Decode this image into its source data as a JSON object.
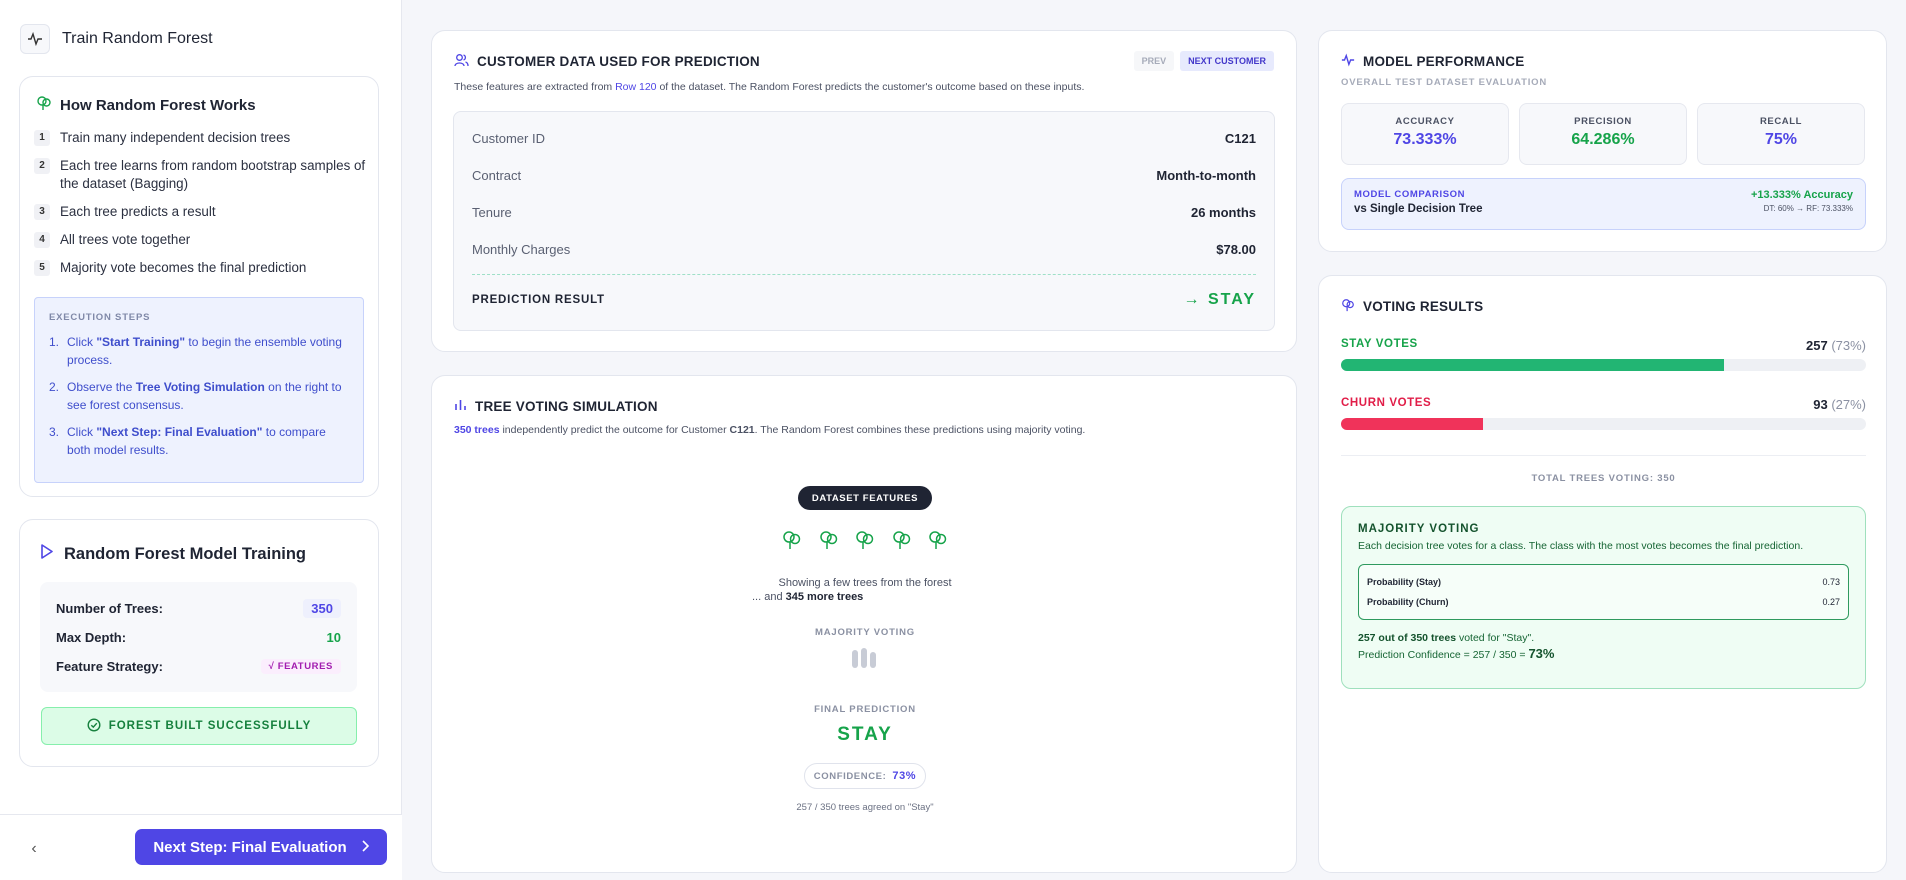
{
  "sidebar": {
    "header_title": "Train Random Forest",
    "how": {
      "title": "How Random Forest Works",
      "steps": [
        {
          "n": "1",
          "text": "Train many independent decision trees"
        },
        {
          "n": "2",
          "text": "Each tree learns from random bootstrap samples of the dataset (Bagging)"
        },
        {
          "n": "3",
          "text": "Each tree predicts a result"
        },
        {
          "n": "4",
          "text": "All trees vote together"
        },
        {
          "n": "5",
          "text": "Majority vote becomes the final prediction"
        }
      ],
      "exec_label": "EXECUTION STEPS",
      "exec_steps": [
        {
          "n": "1.",
          "pre": "Click ",
          "bold": "\"Start Training\"",
          "post": " to begin the ensemble voting process."
        },
        {
          "n": "2.",
          "pre": "Observe the ",
          "bold": "Tree Voting Simulation",
          "post": " on the right to see forest consensus."
        },
        {
          "n": "3.",
          "pre": "Click ",
          "bold": "\"Next Step: Final Evaluation\"",
          "post": " to compare both model results."
        }
      ]
    },
    "training": {
      "title": "Random Forest Model Training",
      "params": [
        {
          "label": "Number of Trees:",
          "value": "350"
        },
        {
          "label": "Max Depth:",
          "value": "10"
        },
        {
          "label": "Feature Strategy:",
          "value": "√ FEATURES"
        }
      ],
      "status": "FOREST BUILT SUCCESSFULLY"
    },
    "footer": {
      "back": "‹",
      "next_label": "Next Step: Final Evaluation"
    }
  },
  "customer": {
    "title": "CUSTOMER DATA USED FOR PREDICTION",
    "sub_pre": "These features are extracted from ",
    "sub_row": "Row 120",
    "sub_post": " of the dataset. The Random Forest predicts the customer's outcome based on these inputs.",
    "prev": "PREV",
    "next": "NEXT CUSTOMER",
    "rows": [
      {
        "k": "Customer ID",
        "v": "C121"
      },
      {
        "k": "Contract",
        "v": "Month-to-month"
      },
      {
        "k": "Tenure",
        "v": "26 months"
      },
      {
        "k": "Monthly Charges",
        "v": "$78.00"
      }
    ],
    "pred_label": "PREDICTION RESULT",
    "pred_value": "→ STAY"
  },
  "simulation": {
    "title": "TREE VOTING SIMULATION",
    "sub_trees": "350 trees",
    "sub_mid": " independently predict the outcome for Customer ",
    "sub_cust": "C121",
    "sub_post": ". The Random Forest combines these predictions using majority voting.",
    "dataset_label": "DATASET FEATURES",
    "note_line1": "Showing a few trees from the forest",
    "note_pre": "... and ",
    "note_more": "345 more trees",
    "majority_label": "MAJORITY VOTING",
    "final_label": "FINAL PREDICTION",
    "final_value": "STAY",
    "conf_label": "CONFIDENCE:",
    "conf_value": "73%",
    "agreed": "257 / 350 trees agreed on \"Stay\""
  },
  "performance": {
    "title": "MODEL PERFORMANCE",
    "subtitle": "OVERALL TEST DATASET EVALUATION",
    "metrics": [
      {
        "label": "ACCURACY",
        "value": "73.333%",
        "color": "#4f46e5"
      },
      {
        "label": "PRECISION",
        "value": "64.286%",
        "color": "#16a34a"
      },
      {
        "label": "RECALL",
        "value": "75%",
        "color": "#4f46e5"
      }
    ],
    "compare_label": "MODEL COMPARISON",
    "compare_sub": "vs Single Decision Tree",
    "compare_gain": "+13.333% Accuracy",
    "compare_detail": "DT: 60% → RF: 73.333%"
  },
  "voting": {
    "title": "VOTING RESULTS",
    "stay": {
      "label": "STAY VOTES",
      "count": "257",
      "pct": "(73%)",
      "fraction": 0.73,
      "color": "#22b573"
    },
    "churn": {
      "label": "CHURN VOTES",
      "count": "93",
      "pct": "(27%)",
      "fraction": 0.27,
      "color": "#f0335a"
    },
    "total": "TOTAL TREES VOTING: 350",
    "majority": {
      "title": "MAJORITY VOTING",
      "desc": "Each decision tree votes for a class. The class with the most votes becomes the final prediction.",
      "probs": [
        {
          "k": "Probability (Stay)",
          "v": "0.73"
        },
        {
          "k": "Probability (Churn)",
          "v": "0.27"
        }
      ],
      "foot_bold": "257 out of 350 trees",
      "foot_post": " voted for \"Stay\".",
      "conf_pre": "Prediction Confidence = 257 / 350 = ",
      "conf_val": "73%"
    }
  }
}
